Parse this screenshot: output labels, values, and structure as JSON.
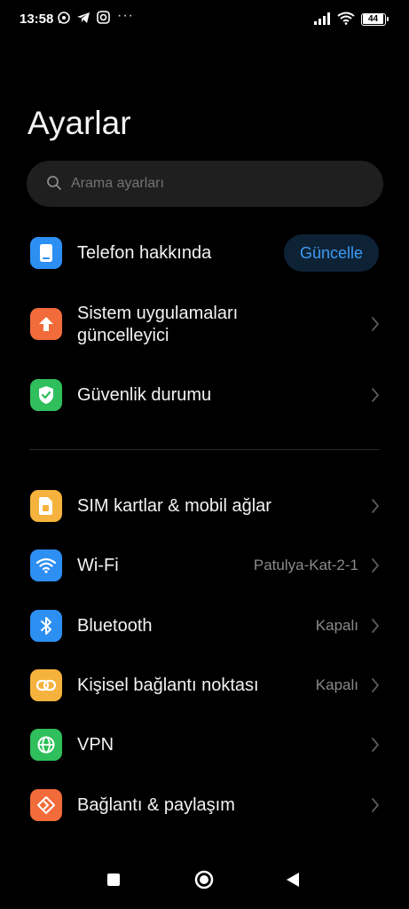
{
  "status_bar": {
    "time": "13:58",
    "notification_icons": [
      "whatsapp-icon",
      "telegram-icon",
      "instagram-icon"
    ],
    "overflow": "···",
    "battery": "44"
  },
  "page": {
    "title": "Ayarlar"
  },
  "search": {
    "placeholder": "Arama ayarları"
  },
  "items": [
    {
      "label": "Telefon hakkında",
      "action": "Güncelle",
      "icon": "phone-icon",
      "color": "#2d8ff2"
    },
    {
      "label": "Sistem uygulamaları güncelleyici",
      "icon": "upload-arrow-icon",
      "color": "#f26b3a"
    },
    {
      "label": "Güvenlik durumu",
      "icon": "shield-check-icon",
      "color": "#2fbf5c"
    },
    {
      "label": "SIM kartlar & mobil ağlar",
      "icon": "sim-card-icon",
      "color": "#f5b23d"
    },
    {
      "label": "Wi-Fi",
      "value": "Patulya-Kat-2-1",
      "icon": "wifi-icon",
      "color": "#2d8ff2"
    },
    {
      "label": "Bluetooth",
      "value": "Kapalı",
      "icon": "bluetooth-icon",
      "color": "#2d8ff2"
    },
    {
      "label": "Kişisel bağlantı noktası",
      "value": "Kapalı",
      "icon": "hotspot-icon",
      "color": "#f5b23d"
    },
    {
      "label": "VPN",
      "icon": "globe-icon",
      "color": "#2fbf5c"
    },
    {
      "label": "Bağlantı & paylaşım",
      "icon": "connection-share-icon",
      "color": "#f26b3a"
    }
  ],
  "navbar": {
    "buttons": [
      "recents-button",
      "home-button",
      "back-button"
    ]
  }
}
